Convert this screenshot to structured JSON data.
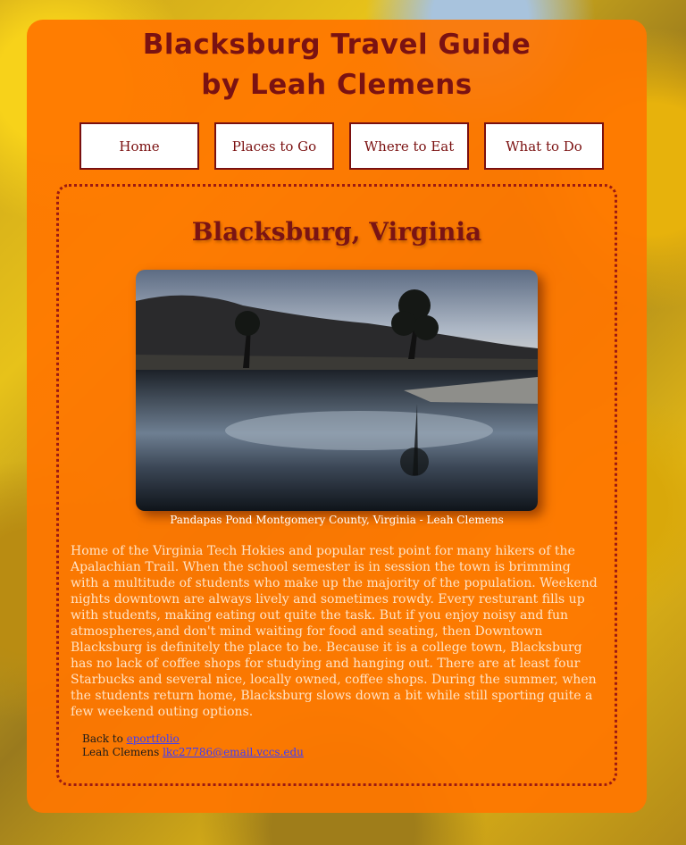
{
  "header": {
    "title_line1": "Blacksburg Travel Guide",
    "title_line2": "by Leah Clemens"
  },
  "nav": {
    "items": [
      {
        "label": "Home"
      },
      {
        "label": "Places to Go"
      },
      {
        "label": "Where to Eat"
      },
      {
        "label": "What to Do"
      }
    ]
  },
  "main": {
    "heading": "Blacksburg, Virginia",
    "image_caption": "Pandapas Pond Montgomery County, Virginia - Leah Clemens",
    "body": "Home of the Virginia Tech Hokies and popular rest point for many hikers of the Apalachian Trail. When the school semester is in session the town is brimming with a multitude of students who make up the majority of the population. Weekend nights downtown are always lively and sometimes rowdy. Every resturant fills up with students, making eating out quite the task. But if you enjoy noisy and fun atmospheres,and don't mind waiting for food and seating, then Downtown Blacksburg is definitely the place to be. Because it is a college town, Blacksburg has no lack of coffee shops for studying and hanging out. There are at least four Starbucks and several nice, locally owned, coffee shops. During the summer, when the students return home, Blacksburg slows down a bit while still sporting quite a few weekend outing options."
  },
  "footer": {
    "back_prefix": "Back to ",
    "back_link": "eportfolio",
    "author_prefix": "Leah Clemens ",
    "email_link": "lkc27786@email.vccs.edu"
  },
  "colors": {
    "panel": "#ff7600",
    "title": "#7a1212",
    "nav_border": "#7a1010",
    "link": "#3b3bff"
  }
}
